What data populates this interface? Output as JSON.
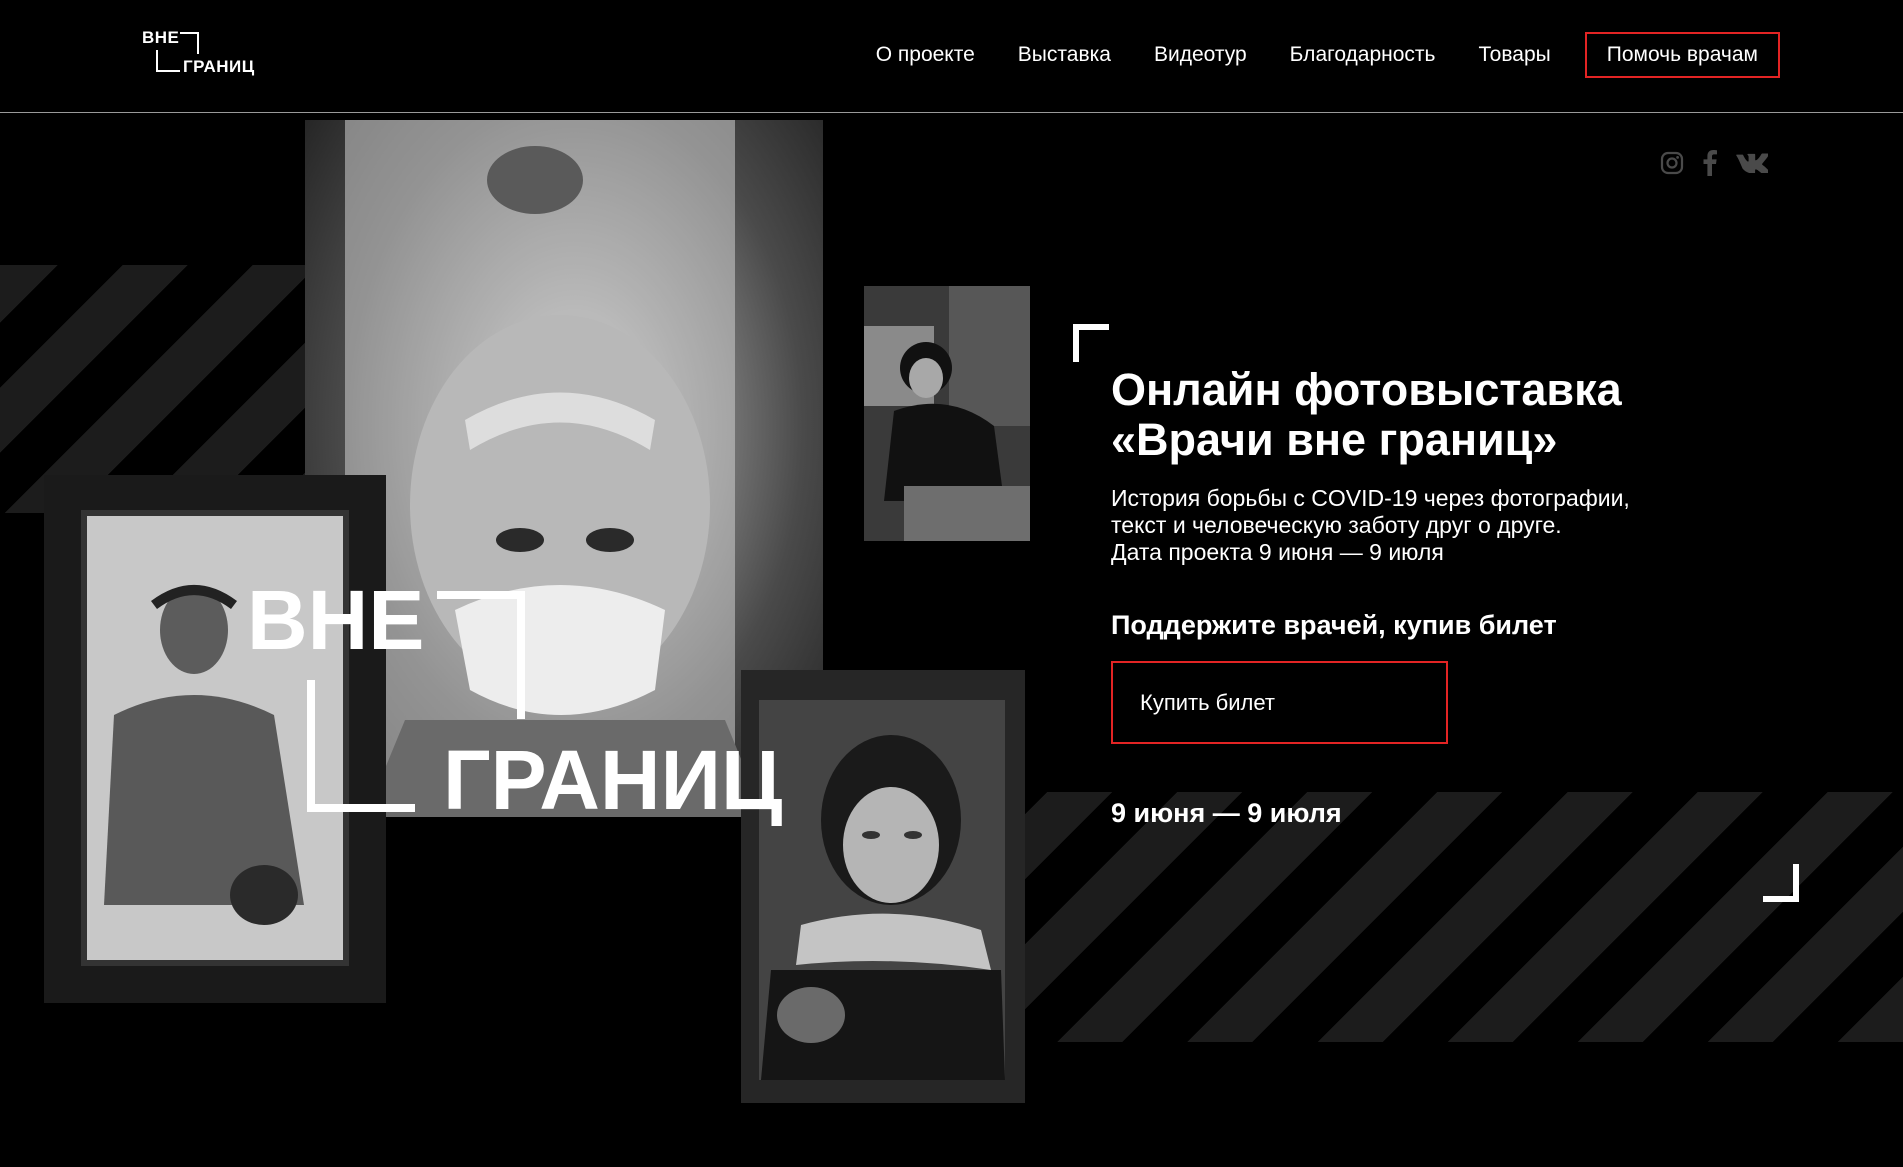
{
  "brand": {
    "line1": "ВНЕ",
    "line2": "ГРАНИЦ"
  },
  "nav": {
    "items": [
      {
        "label": "О проекте"
      },
      {
        "label": "Выставка"
      },
      {
        "label": "Видеотур"
      },
      {
        "label": "Благодарность"
      },
      {
        "label": "Товары"
      }
    ],
    "cta": "Помочь врачам"
  },
  "social": [
    "instagram-icon",
    "facebook-icon",
    "vk-icon"
  ],
  "hero": {
    "big_line1": "ВНЕ",
    "big_line2": "ГРАНИЦ",
    "title_line1": "Онлайн фотовыставка",
    "title_line2": "«Врачи вне границ»",
    "desc_line1": "История борьбы с COVID-19 через фотографии,",
    "desc_line2": "текст и человеческую заботу друг о друге.",
    "desc_line3": "Дата проекта 9 июня — 9 июля",
    "support": "Поддержите врачей, купив билет",
    "buy_label": "Купить билет",
    "dates": "9 июня — 9 июля"
  },
  "colors": {
    "accent": "#e32424",
    "background": "#000000"
  }
}
